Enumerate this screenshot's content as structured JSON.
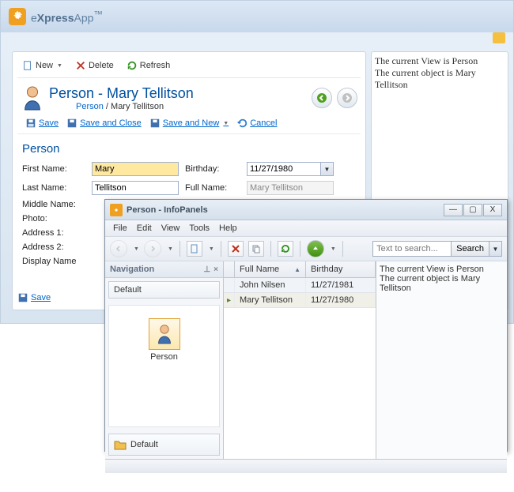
{
  "brand": {
    "name_light": "e",
    "name_bold": "Xpress",
    "name_rest": "App",
    "tm": "™"
  },
  "toolbar": {
    "new": "New",
    "delete": "Delete",
    "refresh": "Refresh"
  },
  "header": {
    "title": "Person - Mary Tellitson",
    "breadcrumb_link": "Person",
    "breadcrumb_current": "Mary Tellitson"
  },
  "actions": {
    "save": "Save",
    "save_and_close": "Save and Close",
    "save_and_new": "Save and New",
    "cancel": "Cancel"
  },
  "section_title": "Person",
  "form": {
    "first_name_label": "First Name:",
    "first_name_value": "Mary",
    "last_name_label": "Last Name:",
    "last_name_value": "Tellitson",
    "middle_name_label": "Middle Name:",
    "photo_label": "Photo:",
    "address1_label": "Address 1:",
    "address2_label": "Address 2:",
    "display_name_label": "Display Name",
    "birthday_label": "Birthday:",
    "birthday_value": "11/27/1980",
    "full_name_label": "Full Name:",
    "full_name_value": "Mary Tellitson"
  },
  "bottom": {
    "save": "Save"
  },
  "info": {
    "line1": "The current View is Person",
    "line2": "The current object is Mary Tellitson"
  },
  "sub": {
    "title": "Person - InfoPanels",
    "menu": {
      "file": "File",
      "edit": "Edit",
      "view": "View",
      "tools": "Tools",
      "help": "Help"
    },
    "search_placeholder": "Text to search...",
    "search_btn": "Search",
    "nav": {
      "title": "Navigation",
      "default": "Default",
      "person": "Person",
      "footer": "Default"
    },
    "grid": {
      "col_fullname": "Full Name",
      "col_birthday": "Birthday",
      "rows": [
        {
          "fullname": "John Nilsen",
          "birthday": "11/27/1981",
          "selected": false
        },
        {
          "fullname": "Mary Tellitson",
          "birthday": "11/27/1980",
          "selected": true
        }
      ]
    },
    "info": {
      "line1": "The current View is Person",
      "line2": "The current object is Mary Tellitson"
    }
  }
}
